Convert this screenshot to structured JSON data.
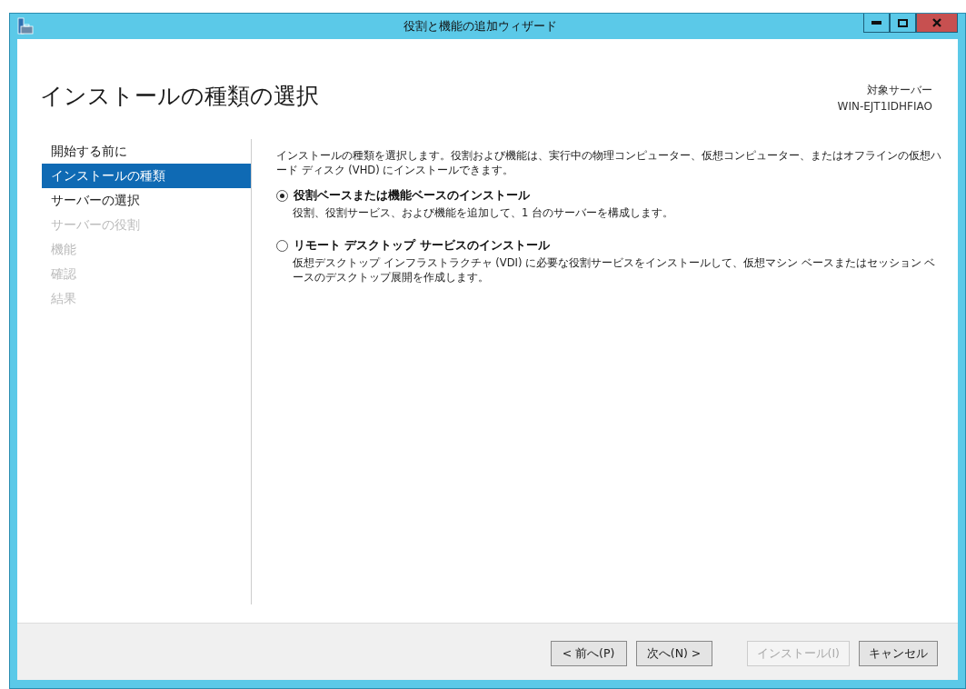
{
  "window": {
    "title": "役割と機能の追加ウィザード"
  },
  "header": {
    "title": "インストールの種類の選択",
    "target_label": "対象サーバー",
    "target_name": "WIN-EJT1IDHFIAO"
  },
  "steps": [
    {
      "label": "開始する前に",
      "selected": false,
      "disabled": false
    },
    {
      "label": "インストールの種類",
      "selected": true,
      "disabled": false
    },
    {
      "label": "サーバーの選択",
      "selected": false,
      "disabled": false
    },
    {
      "label": "サーバーの役割",
      "selected": false,
      "disabled": true
    },
    {
      "label": "機能",
      "selected": false,
      "disabled": true
    },
    {
      "label": "確認",
      "selected": false,
      "disabled": true
    },
    {
      "label": "結果",
      "selected": false,
      "disabled": true
    }
  ],
  "description": "インストールの種類を選択します。役割および機能は、実行中の物理コンピューター、仮想コンピューター、またはオフラインの仮想ハード ディスク (VHD) にインストールできます。",
  "options": [
    {
      "label": "役割ベースまたは機能ベースのインストール",
      "detail": "役割、役割サービス、および機能を追加して、1 台のサーバーを構成します。",
      "selected": true
    },
    {
      "label": "リモート デスクトップ サービスのインストール",
      "detail": "仮想デスクトップ インフラストラクチャ (VDI) に必要な役割サービスをインストールして、仮想マシン ベースまたはセッション ベースのデスクトップ展開を作成します。",
      "selected": false
    }
  ],
  "buttons": [
    {
      "label": "< 前へ(P)",
      "disabled": false
    },
    {
      "label": "次へ(N) >",
      "disabled": false
    },
    {
      "label": "インストール(I)",
      "disabled": true
    },
    {
      "label": "キャンセル",
      "disabled": false
    }
  ]
}
